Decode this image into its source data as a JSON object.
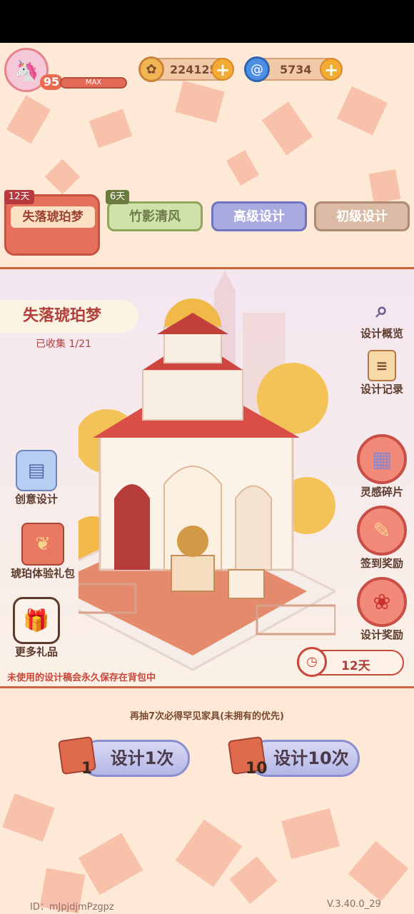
{
  "header": {
    "avatar_icon": "unicorn-avatar-icon",
    "level": "95",
    "level_status": "MAX",
    "coins": {
      "icon": "coin-icon",
      "value": "224125"
    },
    "gems": {
      "icon": "swirl-gem-icon",
      "value": "5734"
    }
  },
  "tabs": [
    {
      "label": "失落琥珀梦",
      "badge": "12天"
    },
    {
      "label": "竹影清风",
      "badge": "6天"
    },
    {
      "label": "高级设计"
    },
    {
      "label": "初级设计"
    }
  ],
  "banner": {
    "title": "失落琥珀梦",
    "collected": "已收集 1/21",
    "timer": "12天",
    "note": "未使用的设计稿会永久保存在背包中"
  },
  "right_menu": [
    {
      "label": "设计概览",
      "icon": "magnifier-icon"
    },
    {
      "label": "设计记录",
      "icon": "clipboard-icon"
    },
    {
      "label": "灵感碎片",
      "icon": "map-pieces-icon"
    },
    {
      "label": "签到奖励",
      "icon": "calendar-pen-icon"
    },
    {
      "label": "设计奖励",
      "icon": "rose-icon"
    }
  ],
  "left_menu": [
    {
      "label": "创意设计",
      "icon": "blueprint-icon"
    },
    {
      "label": "琥珀体验礼包",
      "icon": "gift-chest-icon"
    },
    {
      "label": "更多礼品",
      "icon": "gift-box-icon"
    }
  ],
  "draw": {
    "hint": "再抽7次必得罕见家具(未拥有的优先)",
    "single": {
      "label": "设计1次",
      "count": "1"
    },
    "ten": {
      "label": "设计10次",
      "count": "10"
    }
  },
  "footer": {
    "id": "ID：mJpjdjmPzgpz",
    "version": "V.3.40.0_29"
  }
}
